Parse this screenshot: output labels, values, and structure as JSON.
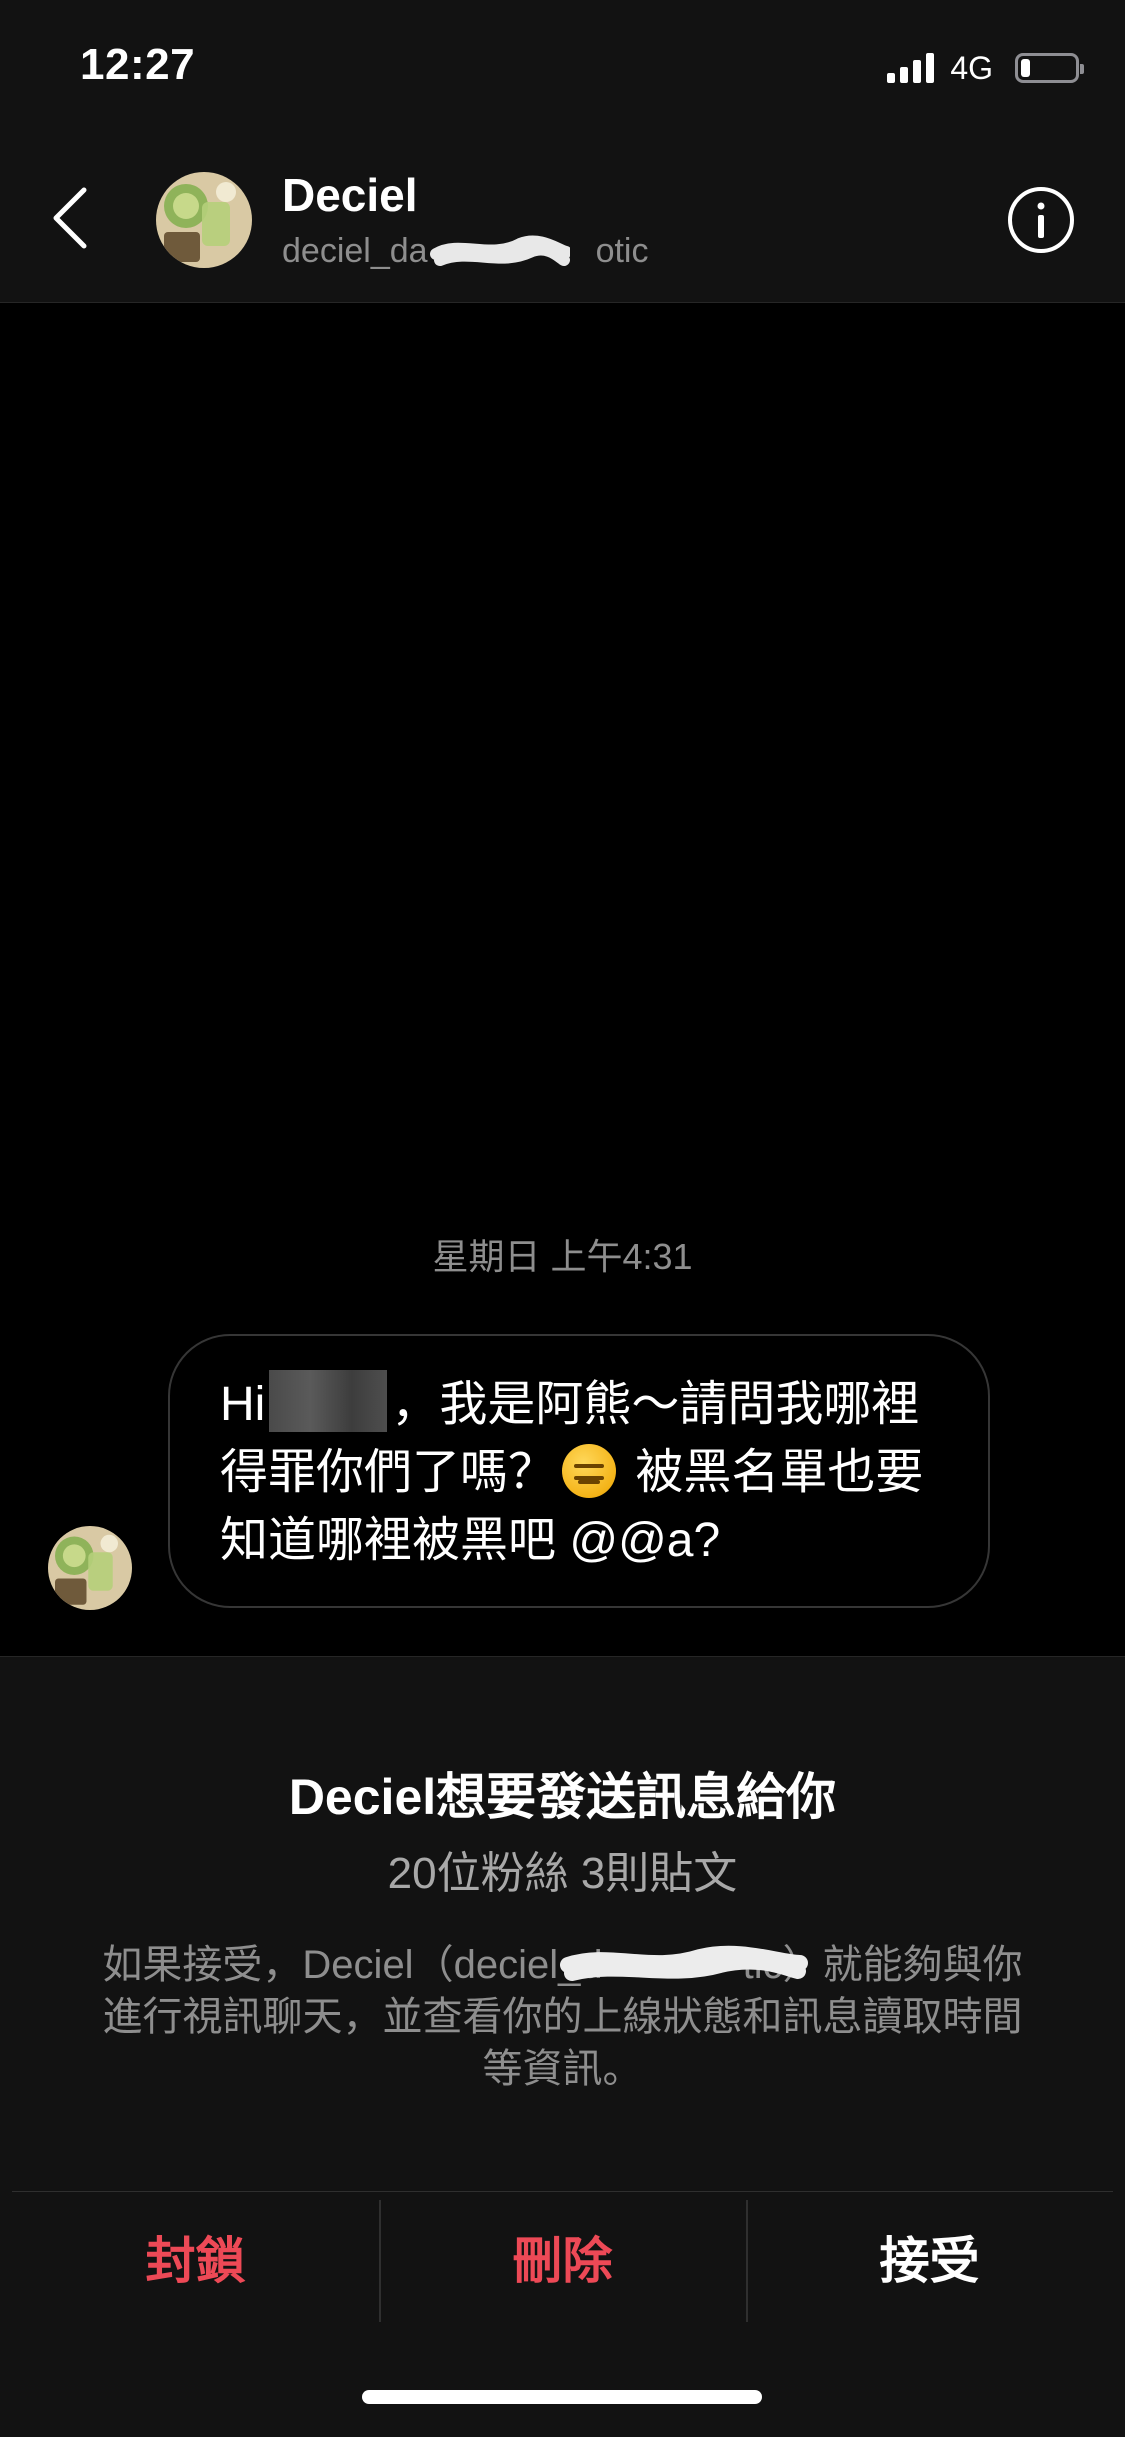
{
  "status_bar": {
    "time": "12:27",
    "network": "4G",
    "battery_level": 0.18
  },
  "header": {
    "name": "Deciel",
    "username_visible": "deciel_da",
    "username_tail": "otic",
    "back_icon": "chevron-left-icon",
    "info_icon": "info-circle-icon"
  },
  "conversation": {
    "timestamp": "星期日 上午4:31",
    "message": {
      "part_1": "Hi",
      "part_2": "，我是阿熊～請問我哪裡得罪你們了嗎？",
      "emoji": "😑",
      "part_3": " 被黑名單也要知道哪裡被黑吧 @@a?"
    }
  },
  "request": {
    "title_name": "Deciel",
    "title_text": "想要發送訊息給你",
    "stats": "20位粉絲 3則貼文",
    "desc_prefix": "如果接受，Deciel（deciel_d",
    "desc_suffix": "tic）就能夠與你進行視訊聊天，並查看你的上線狀態和訊息讀取時間等資訊。"
  },
  "actions": {
    "block": "封鎖",
    "delete": "刪除",
    "accept": "接受"
  },
  "colors": {
    "background": "#000000",
    "panel": "#121212",
    "danger": "#ed4956",
    "muted": "#8e8e8e"
  }
}
